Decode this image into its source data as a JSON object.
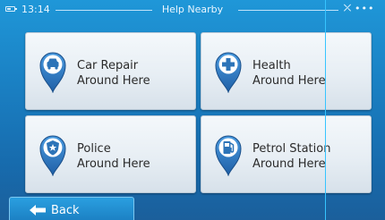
{
  "status_bar": {
    "time": "13:14",
    "title": "Help Nearby",
    "gps_icon": "satellite-icon",
    "menu_icon": "more-dots-icon"
  },
  "tiles": [
    {
      "line1": "Car Repair",
      "line2": "Around Here",
      "icon": "car-repair-icon"
    },
    {
      "line1": "Health",
      "line2": "Around Here",
      "icon": "health-cross-icon"
    },
    {
      "line1": "Police",
      "line2": "Around Here",
      "icon": "police-badge-icon"
    },
    {
      "line1": "Petrol Station",
      "line2": "Around Here",
      "icon": "fuel-pump-icon"
    }
  ],
  "back_button": {
    "label": "Back",
    "icon": "back-arrow-icon"
  },
  "colors": {
    "background": "#1a7fc2",
    "pin": "#2d74b8",
    "tile": "#e7eef4",
    "text": "#2b2b2b"
  }
}
